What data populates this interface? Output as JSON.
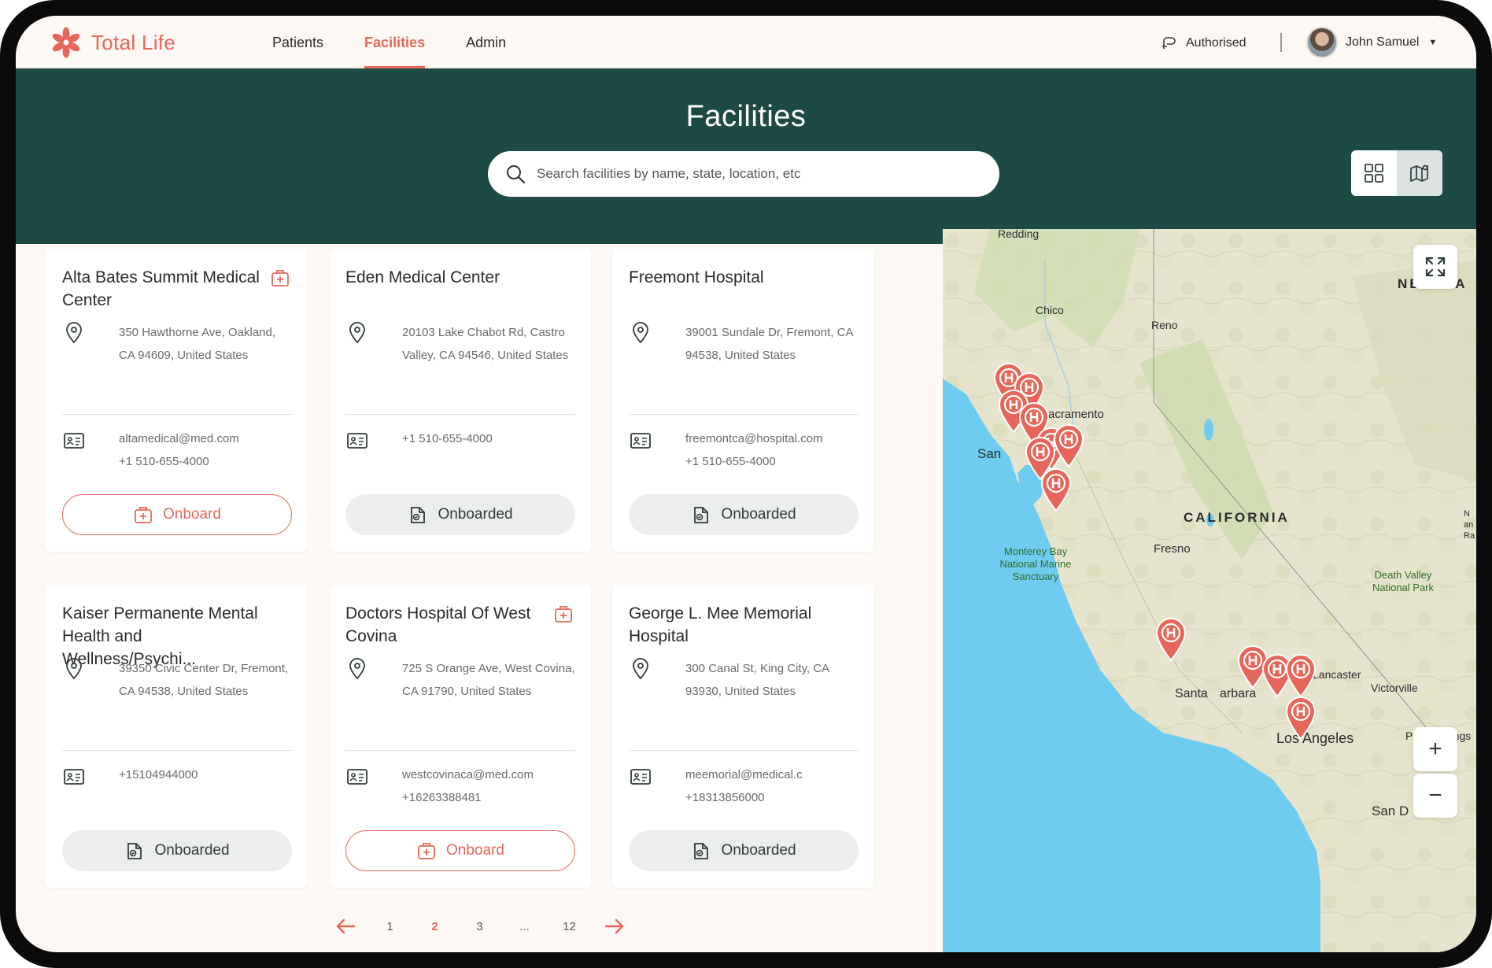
{
  "app": {
    "name": "Total Life"
  },
  "nav": [
    {
      "label": "Patients"
    },
    {
      "label": "Facilities",
      "active": true
    },
    {
      "label": "Admin"
    }
  ],
  "header": {
    "status_label": "Authorised",
    "user_name": "John Samuel",
    "title": "Facilities"
  },
  "search": {
    "placeholder": "Search facilities by name, state, location, etc",
    "value": ""
  },
  "view_toggle": {
    "options": [
      "grid-view-icon",
      "map-view-icon"
    ],
    "selected": "map-view-icon"
  },
  "cards": [
    {
      "name": "Alta Bates Summit Medical Center",
      "address": "350 Hawthorne Ave, Oakland, CA 94609, United States",
      "email": "altamedical@med.com",
      "phone": "+1 510-655-4000",
      "button": "Onboard",
      "status": "not-onboarded",
      "badge": true
    },
    {
      "name": "Eden Medical Center",
      "address": "20103 Lake Chabot Rd, Castro Valley, CA 94546, United States",
      "email": "",
      "phone": "+1 510-655-4000",
      "button": "Onboarded",
      "status": "onboarded",
      "badge": false
    },
    {
      "name": "Freemont Hospital",
      "address": "39001 Sundale Dr, Fremont, CA 94538, United States",
      "email": "freemontca@hospital.com",
      "phone": "+1 510-655-4000",
      "button": "Onboarded",
      "status": "onboarded",
      "badge": false
    },
    {
      "name": "Kaiser Permanente Mental Health and Wellness/Psychi...",
      "address": "39350 Civic Center Dr, Fremont, CA 94538, United States",
      "email": "",
      "phone": "+15104944000",
      "button": "Onboarded",
      "status": "onboarded",
      "badge": false
    },
    {
      "name": "Doctors Hospital Of West Covina",
      "address": "725 S Orange Ave, West Covina, CA 91790, United States",
      "email": "westcovinaca@med.com",
      "phone": "+16263388481",
      "button": "Onboard",
      "status": "not-onboarded",
      "badge": true
    },
    {
      "name": "George L. Mee Memorial Hospital",
      "address": "300 Canal St, King City, CA 93930, United States",
      "email": "meemorial@medical.c",
      "phone": "+18313856000",
      "button": "Onboarded",
      "status": "onboarded",
      "badge": false
    }
  ],
  "pagination": {
    "pages": [
      "1",
      "2",
      "3",
      "...",
      "12"
    ],
    "current": "2"
  },
  "map": {
    "labels": {
      "redding": "Redding",
      "chico": "Chico",
      "reno": "Reno",
      "nevada": "NEVADA",
      "sacramento": "Sacramento",
      "san_francisco_left": "San",
      "san_francisco_right": "co",
      "california": "CALIFORNIA",
      "fresno": "Fresno",
      "monterey": "Monterey Bay National Marine Sanctuary",
      "death_valley": "Death Valley National Park",
      "lancaster": "Lancaster",
      "victorville": "Victorville",
      "santa_barbara_left": "Santa",
      "santa_barbara_right": "arbara",
      "los_angeles": "Los Angeles",
      "palm_springs": "Palm Springs",
      "san_diego": "San D",
      "edge_text": "N an Ra"
    },
    "controls": {
      "zoom_in": "+",
      "zoom_out": "−"
    }
  },
  "colors": {
    "brand": "#e6675a",
    "header_bg": "#1e4a45",
    "page_bg": "#fdf8f3",
    "water": "#6fcbef",
    "land": "#e7e4cd"
  }
}
